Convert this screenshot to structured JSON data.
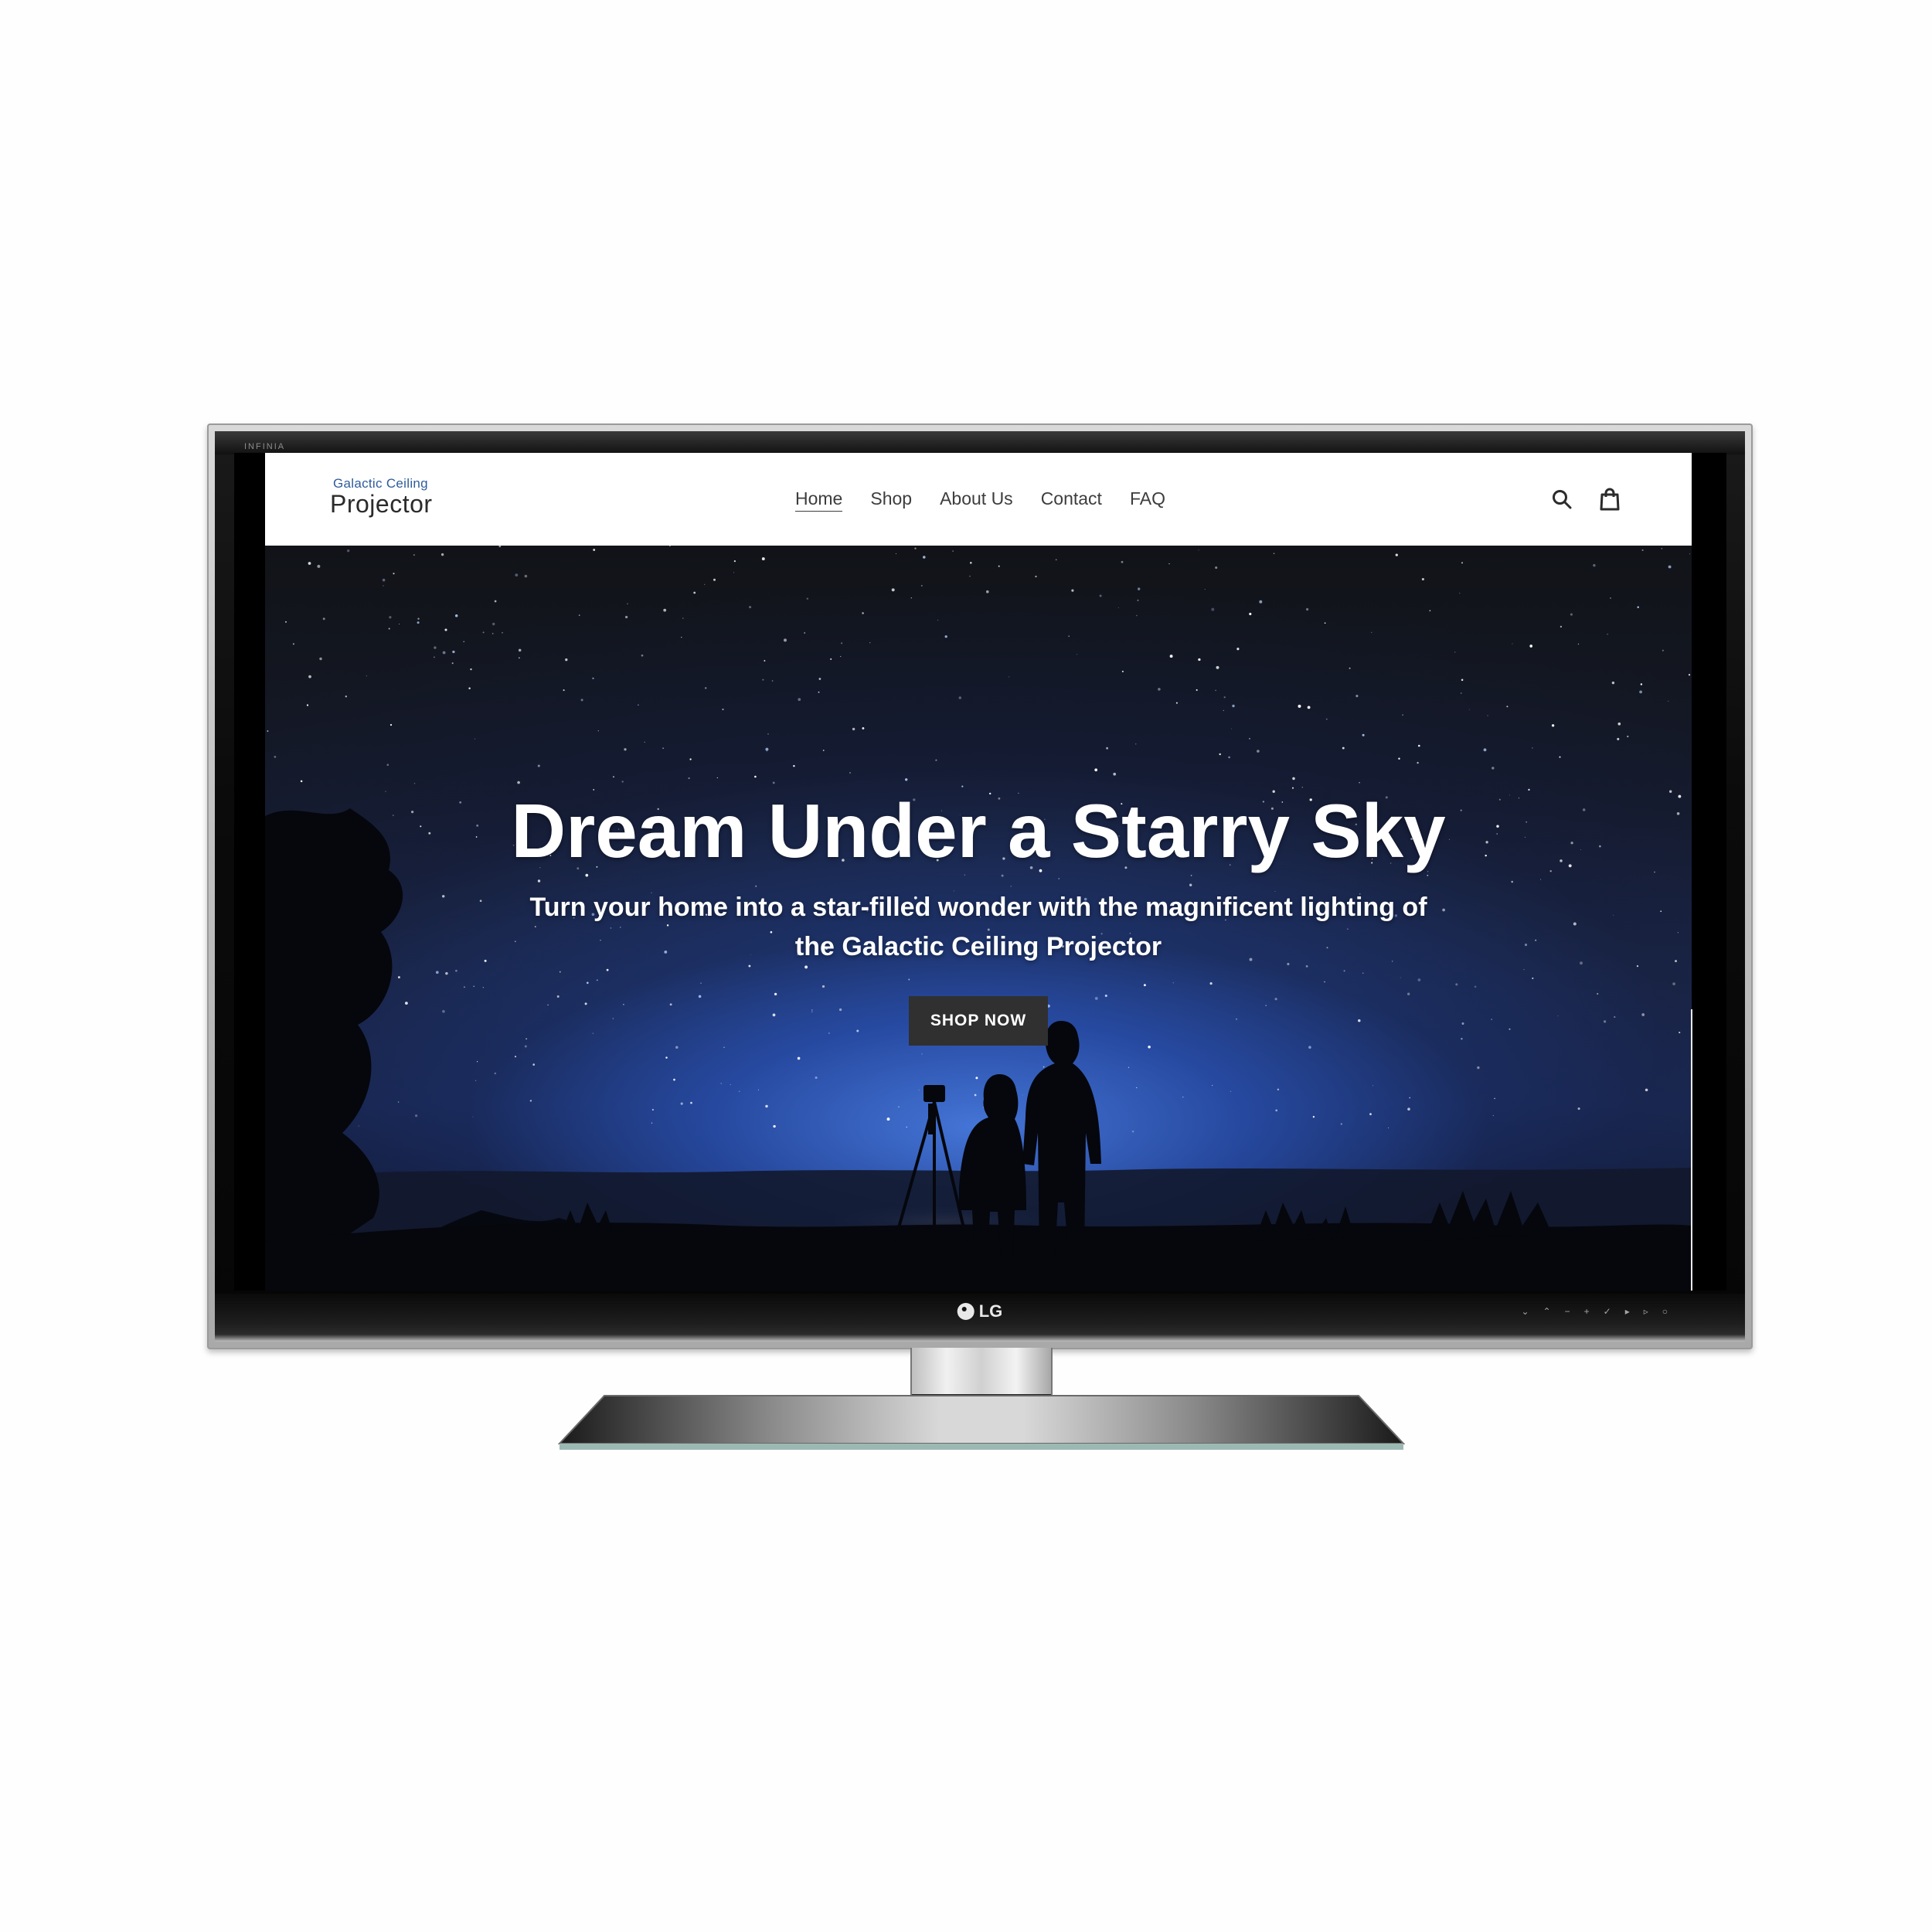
{
  "tv": {
    "bezel_brand": "INFINIA",
    "logo_text": "LG",
    "control_glyphs": [
      "⌄",
      "⌃",
      "−",
      "+",
      "✓",
      "▸",
      "▹",
      "○"
    ]
  },
  "site": {
    "logo": {
      "top_line": "Galactic Ceiling",
      "main_line": "Projector"
    },
    "nav": [
      {
        "label": "Home",
        "active": true
      },
      {
        "label": "Shop",
        "active": false
      },
      {
        "label": "About Us",
        "active": false
      },
      {
        "label": "Contact",
        "active": false
      },
      {
        "label": "FAQ",
        "active": false
      }
    ],
    "icons": {
      "search": "search-icon",
      "cart": "cart-icon"
    }
  },
  "hero": {
    "title": "Dream Under a Starry Sky",
    "subtitle": "Turn your home into a star-filled wonder with the magnificent lighting of the Galactic Ceiling Projector",
    "cta_label": "SHOP NOW"
  },
  "colors": {
    "cta_bg": "#303030",
    "logo_accent": "#2f5b9c",
    "nav_text": "#3d3d3d"
  }
}
